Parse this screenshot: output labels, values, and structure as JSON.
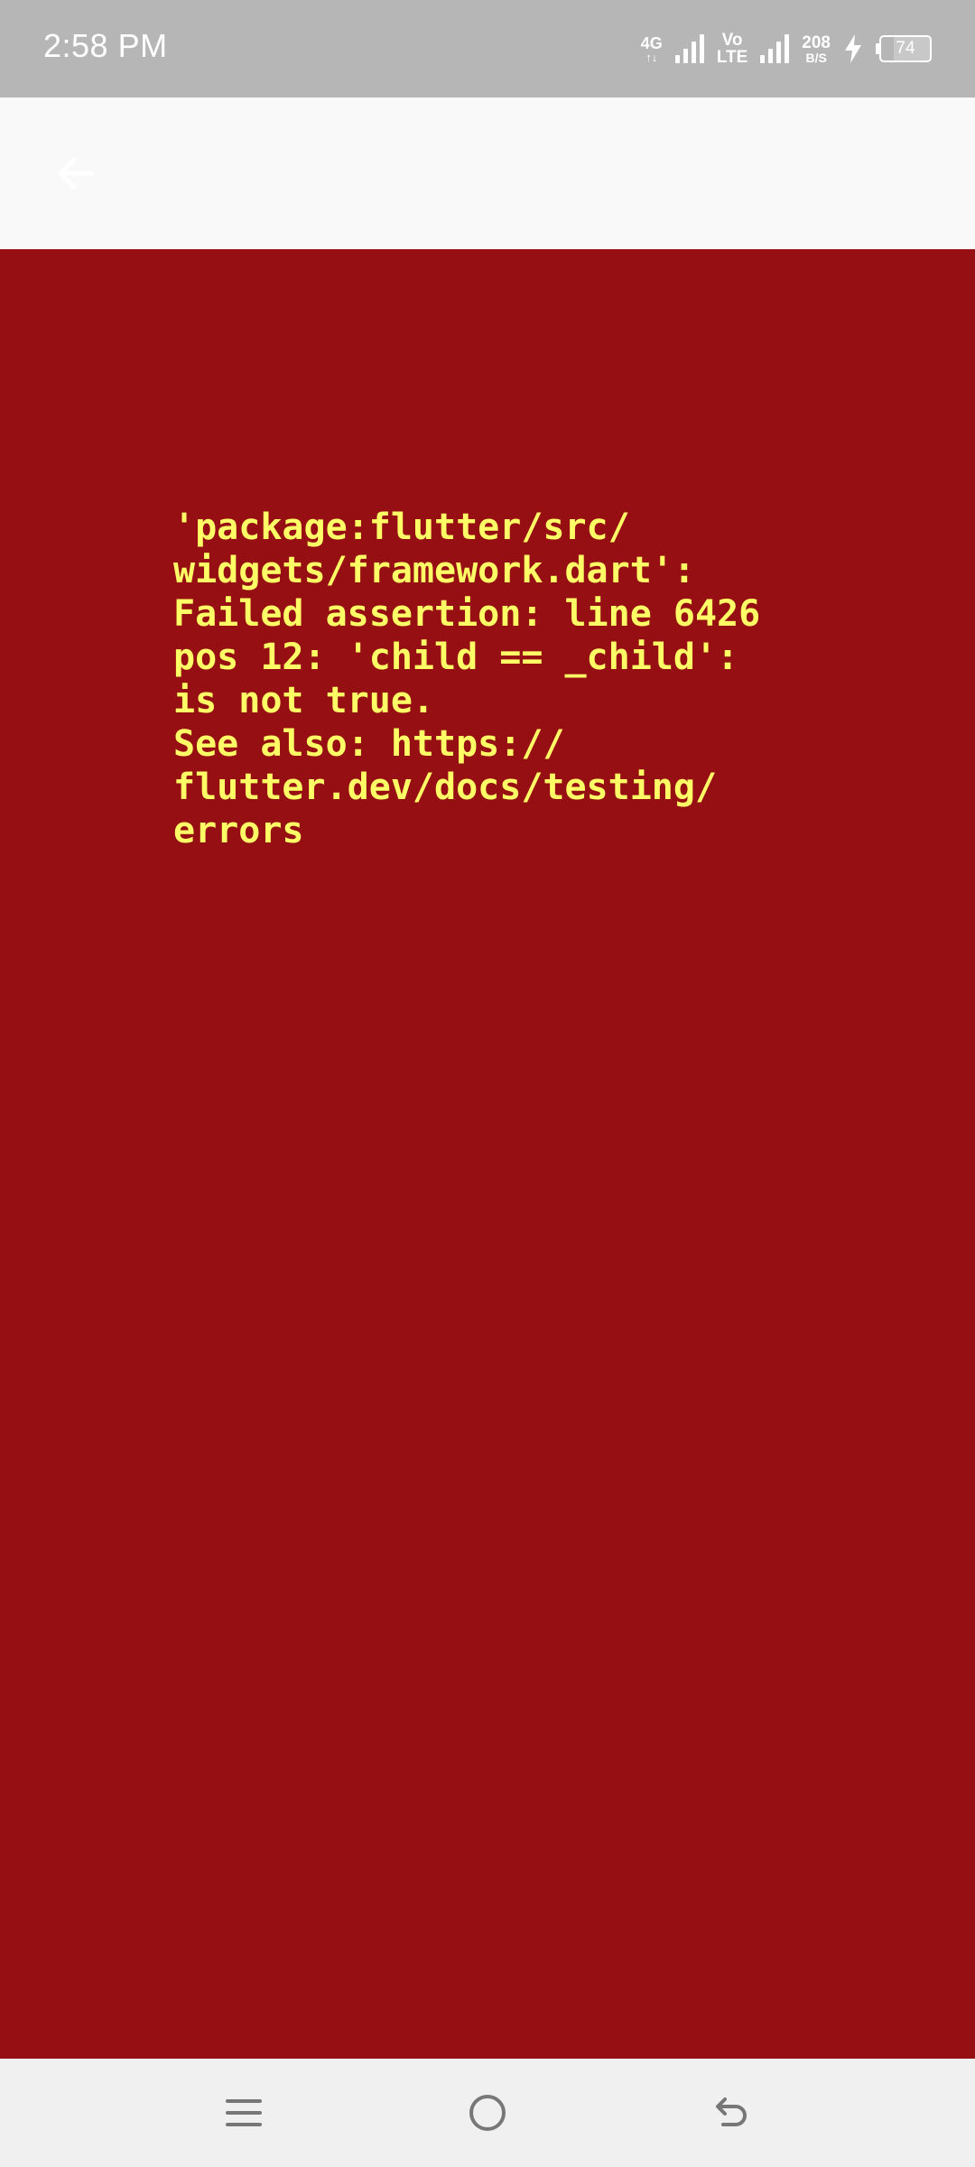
{
  "status_bar": {
    "time": "2:58 PM",
    "network_type": "4G",
    "network_sub": "↑↓",
    "volte_top": "Vo",
    "volte_bottom": "LTE",
    "speed_value": "208",
    "speed_unit": "B/S",
    "battery_level": "74",
    "icons": [
      "signal-icon",
      "signal-icon",
      "charging-icon",
      "battery-icon"
    ]
  },
  "app_bar": {
    "back_icon": "arrow-left-icon"
  },
  "error": {
    "text": "'package:flutter/src/\nwidgets/framework.dart':\nFailed assertion: line 6426\npos 12: 'child == _child':\nis not true.\nSee also: https://\nflutter.dev/docs/testing/\nerrors"
  },
  "nav_bar": {
    "icons": [
      "menu-icon",
      "home-icon",
      "back-icon"
    ]
  },
  "colors": {
    "status_bar_bg": "#b6b6b6",
    "app_bar_bg": "#f9f9f9",
    "error_bg": "#960f12",
    "error_text": "#ffff66",
    "nav_bar_bg": "#f0f0f0"
  }
}
